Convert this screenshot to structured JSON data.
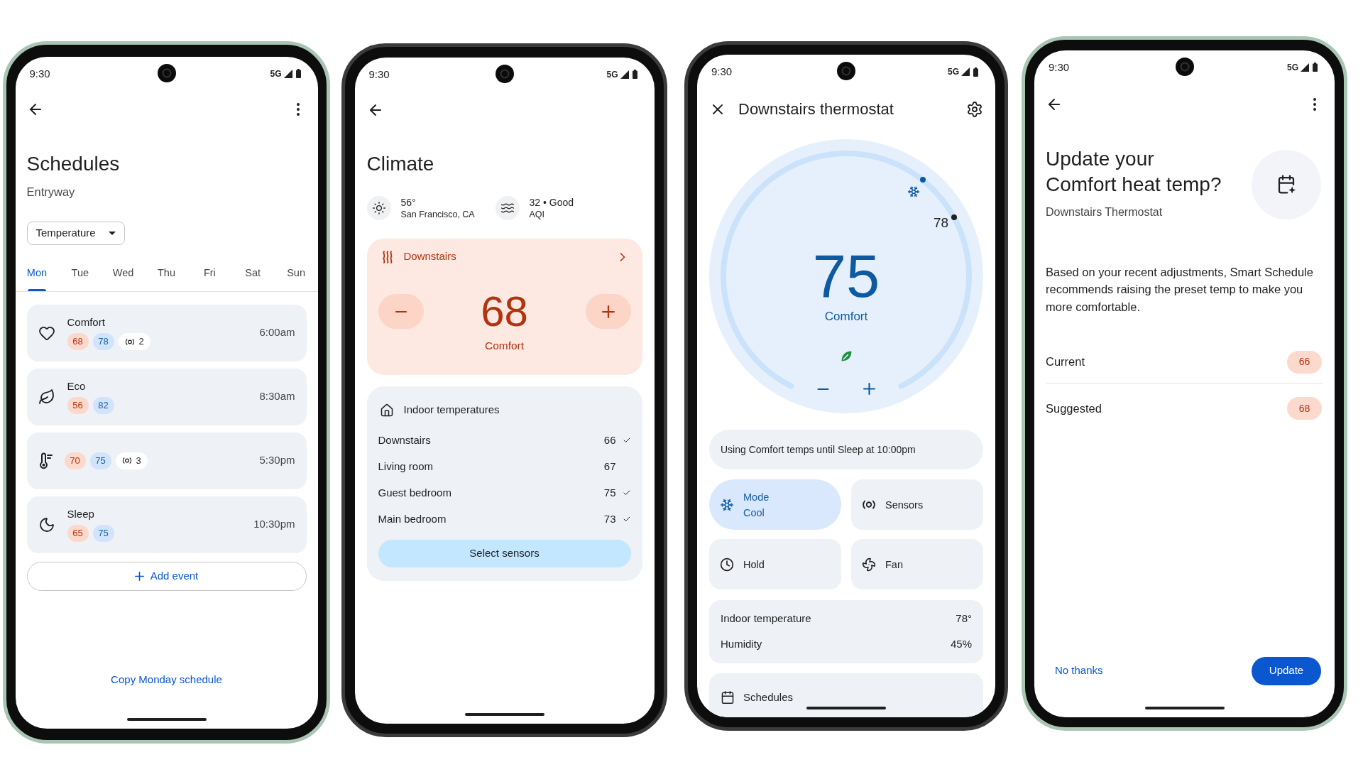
{
  "phones": [
    {
      "kind": "schedules",
      "status_bar": {
        "time": "9:30",
        "network": "5G"
      },
      "title": "Schedules",
      "subtitle": "Entryway",
      "filter": {
        "value": "Temperature"
      },
      "days": [
        {
          "label": "Mon",
          "selected": true
        },
        {
          "label": "Tue",
          "selected": false
        },
        {
          "label": "Wed",
          "selected": false
        },
        {
          "label": "Thu",
          "selected": false
        },
        {
          "label": "Fri",
          "selected": false
        },
        {
          "label": "Sat",
          "selected": false
        },
        {
          "label": "Sun",
          "selected": false
        }
      ],
      "events": [
        {
          "title": "Comfort",
          "heat": "68",
          "cool": "78",
          "sensors": "2",
          "time": "6:00am"
        },
        {
          "title": "Eco",
          "heat": "56",
          "cool": "82",
          "time": "8:30am"
        },
        {
          "heat": "70",
          "cool": "75",
          "sensors": "3",
          "time": "5:30pm"
        },
        {
          "title": "Sleep",
          "heat": "65",
          "cool": "75",
          "time": "10:30pm"
        }
      ],
      "add_button": "Add event",
      "copy_link": "Copy Monday schedule"
    },
    {
      "kind": "climate",
      "status_bar": {
        "time": "9:30",
        "network": "5G"
      },
      "title": "Climate",
      "outdoor": [
        {
          "value": "56°",
          "label": "San Francisco, CA"
        },
        {
          "value": "32 • Good",
          "label": "AQI"
        }
      ],
      "zone": {
        "name": "Downstairs",
        "setpoint": "68",
        "preset": "Comfort"
      },
      "indoor": {
        "title": "Indoor temperatures",
        "rooms": [
          {
            "name": "Downstairs",
            "temp": "66",
            "checked": true
          },
          {
            "name": "Living room",
            "temp": "67",
            "checked": false
          },
          {
            "name": "Guest bedroom",
            "temp": "75",
            "checked": true
          },
          {
            "name": "Main bedroom",
            "temp": "73",
            "checked": true
          }
        ],
        "button": "Select sensors"
      }
    },
    {
      "kind": "thermostat",
      "status_bar": {
        "time": "9:30",
        "network": "5G"
      },
      "title": "Downstairs thermostat",
      "dial": {
        "setpoint": "75",
        "preset": "Comfort",
        "current": "78"
      },
      "status": "Using Comfort temps until Sleep at 10:00pm",
      "tiles": [
        {
          "label": "Mode",
          "value": "Cool",
          "selected": true
        },
        {
          "label": "Sensors",
          "selected": false
        },
        {
          "label": "Hold",
          "selected": false
        },
        {
          "label": "Fan",
          "selected": false
        }
      ],
      "readings": [
        {
          "label": "Indoor temperature",
          "value": "78°"
        },
        {
          "label": "Humidity",
          "value": "45%"
        }
      ],
      "schedules": "Schedules"
    },
    {
      "kind": "suggestion",
      "status_bar": {
        "time": "9:30",
        "network": "5G"
      },
      "title": "Update your Comfort heat temp?",
      "subtitle": "Downstairs Thermostat",
      "body": "Based on your recent adjustments, Smart Schedule recommends raising the preset temp to make you more comfortable.",
      "comparison": [
        {
          "label": "Current",
          "value": "66"
        },
        {
          "label": "Suggested",
          "value": "68"
        }
      ],
      "actions": {
        "dismiss": "No thanks",
        "confirm": "Update"
      }
    }
  ]
}
